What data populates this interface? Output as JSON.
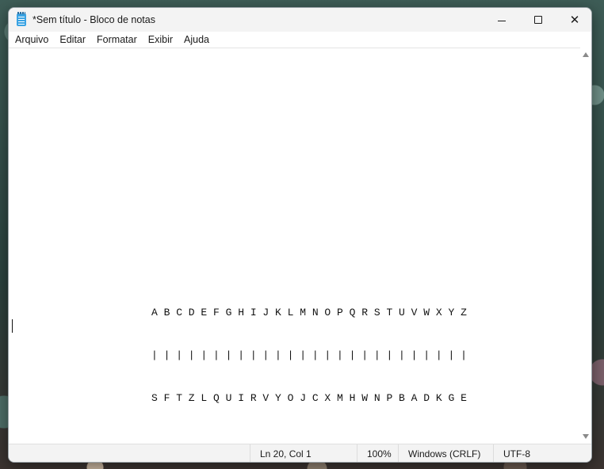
{
  "window": {
    "title": "*Sem título - Bloco de notas"
  },
  "menu": {
    "items": [
      "Arquivo",
      "Editar",
      "Formatar",
      "Exibir",
      "Ajuda"
    ]
  },
  "editor": {
    "lines": [
      "A B C D E F G H I J K L M N O P Q R S T U V W X Y Z",
      "| | | | | | | | | | | | | | | | | | | | | | | | | |",
      "S F T Z L Q U I R V Y O J C X M H W N P B A D K G E"
    ]
  },
  "status": {
    "position": "Ln 20, Col 1",
    "zoom": "100%",
    "line_endings": "Windows (CRLF)",
    "encoding": "UTF-8"
  },
  "icons": {
    "app": "notepad-icon",
    "minimize": "minimize-icon",
    "maximize": "maximize-icon",
    "close": "close-icon"
  }
}
